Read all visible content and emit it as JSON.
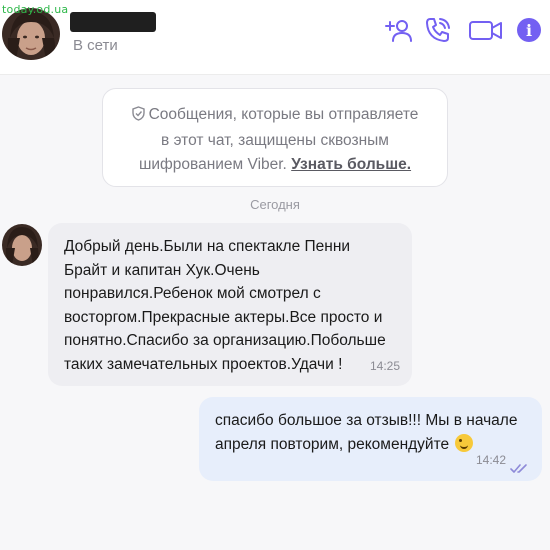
{
  "watermark": "today.od.ua",
  "header": {
    "status": "В сети",
    "icons": [
      "add-contact-icon",
      "phone-icon",
      "video-call-icon",
      "info-icon"
    ],
    "accent": "#7360f2",
    "info_glyph": "i"
  },
  "encryption_notice": {
    "line1": "Сообщения, которые вы отправляете",
    "line2": "в этот чат, защищены сквозным",
    "line3": "шифрованием Viber.",
    "link": "Узнать больше."
  },
  "date_separator": "Сегодня",
  "messages": [
    {
      "direction": "incoming",
      "lines": [
        "Добрый день.Были на спектакле Пенни",
        "Брайт и капитан Хук.Очень",
        "понравился.Ребенок мой смотрел с",
        "восторгом.Прекрасные актеры.Все просто и",
        "понятно.Спасибо за организацию.Побольше",
        "таких замечательных проектов.Удачи !"
      ],
      "time": "14:25"
    },
    {
      "direction": "outgoing",
      "lines": [
        "спасибо большое за отзыв!!! Мы в начале",
        "апреля повторим, рекомендуйте"
      ],
      "time": "14:42",
      "status_icon": "double-check-icon"
    }
  ]
}
